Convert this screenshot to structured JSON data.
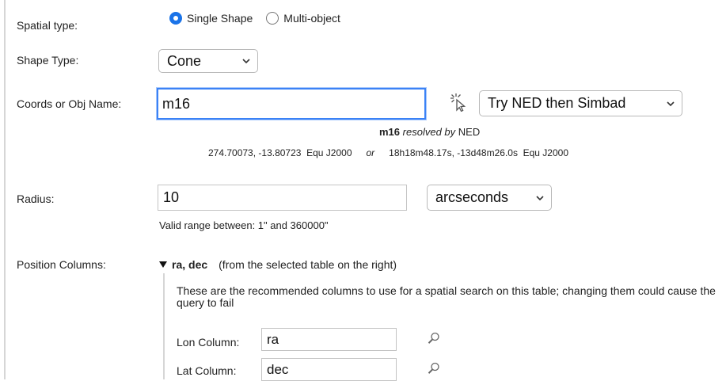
{
  "spatial_type": {
    "label": "Spatial type:",
    "options": [
      "Single Shape",
      "Multi-object"
    ],
    "selected": "Single Shape"
  },
  "shape_type": {
    "label": "Shape Type:",
    "value": "Cone"
  },
  "coords": {
    "label": "Coords or Obj Name:",
    "value": "m16",
    "resolver": "Try NED then Simbad",
    "resolved_name": "m16",
    "resolved_by": "resolved by",
    "resolved_service": "NED",
    "decimal_coords": "274.70073, -13.80723  Equ J2000",
    "or_text": "or",
    "sexagesimal_coords": "18h18m48.17s, -13d48m26.0s  Equ J2000"
  },
  "radius": {
    "label": "Radius:",
    "value": "10",
    "unit": "arcseconds",
    "range_note": "Valid range between: 1\" and 360000\""
  },
  "position_columns": {
    "label": "Position Columns:",
    "summary": "ra, dec",
    "summary_note": "(from the selected table on the right)",
    "recommendation": "These are the recommended columns to use for a spatial search on this table; changing them could cause the query to fail",
    "lon_label": "Lon Column:",
    "lon_value": "ra",
    "lat_label": "Lat Column:",
    "lat_value": "dec"
  },
  "colors": {
    "accent": "#1a73e8",
    "focus": "#3b82f6"
  },
  "icons": {
    "chevron": "chevron-down-icon",
    "pointer": "cursor-pointer-icon",
    "magnifier": "magnifier-icon",
    "disclosure": "triangle-down-icon"
  }
}
